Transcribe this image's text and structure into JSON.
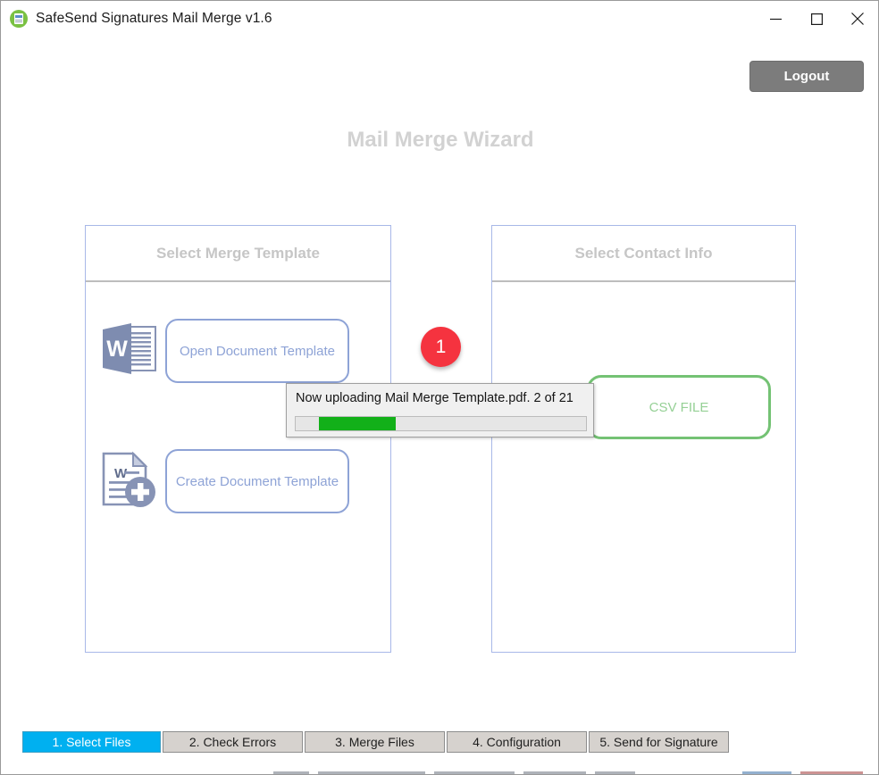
{
  "window": {
    "title": "SafeSend Signatures Mail Merge v1.6",
    "app_icon": "safesend-document-icon",
    "controls": {
      "minimize": "minimize-icon",
      "maximize": "maximize-icon",
      "close": "close-icon"
    }
  },
  "toolbar": {
    "logout_label": "Logout"
  },
  "page": {
    "heading": "Mail Merge Wizard"
  },
  "panels": [
    {
      "id": "merge-template",
      "header": "Select Merge Template",
      "options": [
        {
          "icon": "word-document-icon",
          "label": "Open Document Template"
        },
        {
          "icon": "word-document-add-icon",
          "label": "Create Document Template"
        }
      ]
    },
    {
      "id": "contact-info",
      "header": "Select Contact Info",
      "options": [
        {
          "icon": "csv-file-icon",
          "label": "CSV FILE"
        }
      ]
    }
  ],
  "step_badge": {
    "number": "1"
  },
  "upload": {
    "status_text": "Now uploading Mail Merge Template.pdf. 2 of 21",
    "file_name": "Mail Merge Template.pdf",
    "current_index": "2",
    "total_count": "21",
    "progress_percent": 26,
    "progress_style": "marquee"
  },
  "tabs": [
    {
      "label": "1. Select Files",
      "active": true
    },
    {
      "label": "2. Check Errors",
      "active": false
    },
    {
      "label": "3. Merge Files",
      "active": false
    },
    {
      "label": "4. Configuration",
      "active": false
    },
    {
      "label": "5. Send for Signature",
      "active": false
    }
  ],
  "colors": {
    "accent_tab_active": "#00b0f0",
    "panel_border": "#a8b8e8",
    "outline_button": "#8ea3d6",
    "csv_green": "#74c274",
    "badge_red": "#f5333f",
    "progress_green": "#12b019",
    "logout_gray": "#7c7c7c",
    "heading_gray": "#d2d2d2"
  }
}
